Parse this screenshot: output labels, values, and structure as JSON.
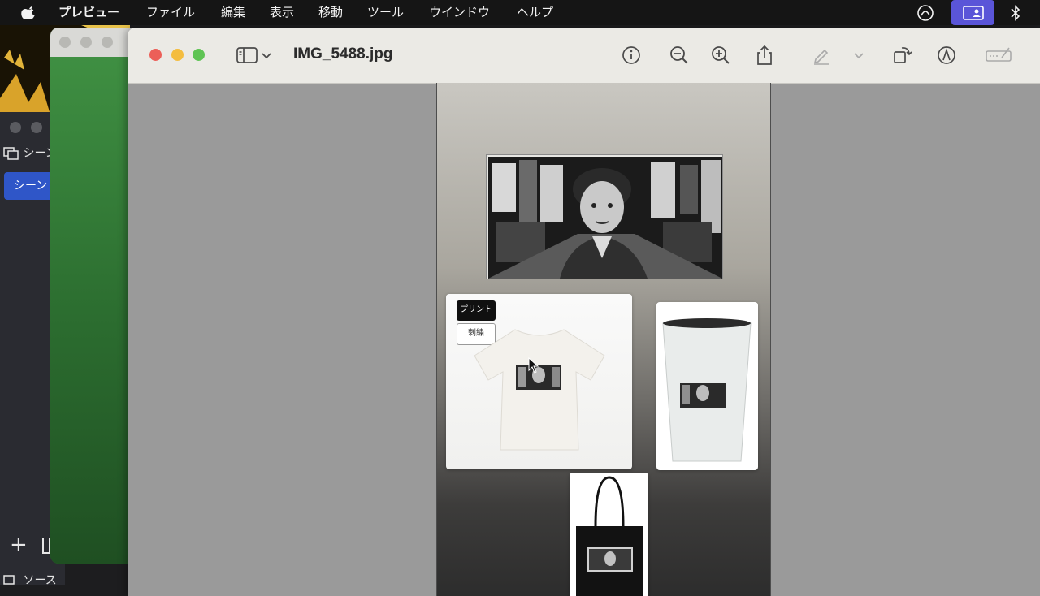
{
  "menubar": {
    "app_name": "プレビュー",
    "menus": [
      "ファイル",
      "編集",
      "表示",
      "移動",
      "ツール",
      "ウインドウ",
      "ヘルプ"
    ],
    "status_icons": [
      "creative-cloud-icon",
      "screen-share-icon",
      "bluetooth-icon"
    ],
    "accent_color": "#5a55d8"
  },
  "obs_window": {
    "scenes_header": "シーン",
    "selected_scene": "シーン",
    "sources_header": "ソース"
  },
  "preview": {
    "title": "IMG_5488.jpg",
    "toolbar_icons": [
      "sidebar-icon",
      "chevron-down-icon",
      "info-icon",
      "zoom-out-icon",
      "zoom-in-icon",
      "share-icon",
      "highlight-pen-icon",
      "chevron-down-icon",
      "rotate-icon",
      "markup-icon",
      "form-fill-icon"
    ]
  },
  "mockups": {
    "option_print": "プリント",
    "option_embroidery": "刺繍"
  }
}
